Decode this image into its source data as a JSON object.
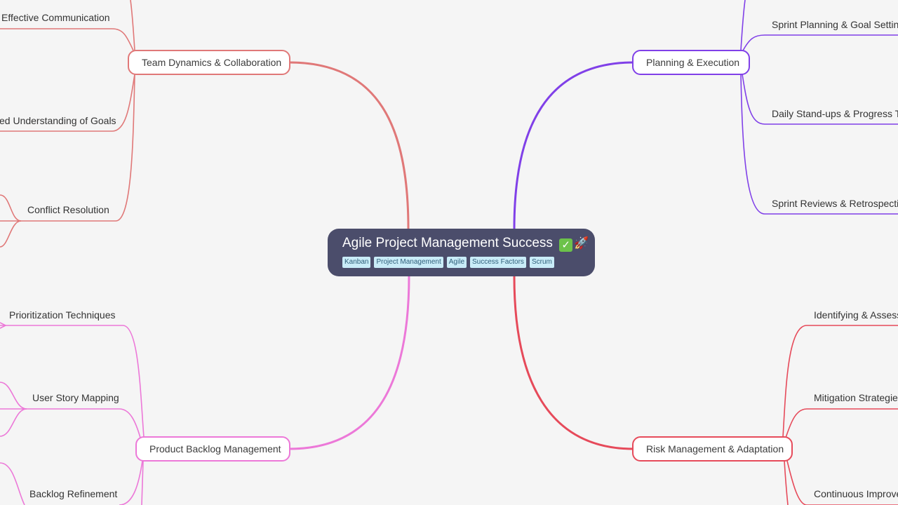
{
  "root": {
    "title": "Agile Project Management Success",
    "emoji_check": "✓",
    "emoji_rocket": "🚀",
    "tags": [
      "Kanban",
      "Project Management",
      "Agile",
      "Success Factors",
      "Scrum"
    ],
    "colors": {
      "background": "#4b4d6b",
      "tag_bg": "#c9ecf8",
      "tag_text": "#2f5f7a"
    }
  },
  "branches": {
    "team": {
      "label": "Team Dynamics & Collaboration",
      "color": "#e07878",
      "children": [
        "Effective Communication",
        "Shared Understanding of Goals",
        "Conflict Resolution"
      ]
    },
    "planning": {
      "label": "Planning & Execution",
      "color": "#8040e8",
      "children": [
        "Sprint Planning & Goal Setting",
        "Daily Stand-ups & Progress Tracking",
        "Sprint Reviews & Retrospectives"
      ]
    },
    "backlog": {
      "label": "Product Backlog Management",
      "color": "#ec78d8",
      "children": [
        "Prioritization Techniques",
        "User Story Mapping",
        "Backlog Refinement"
      ]
    },
    "risk": {
      "label": "Risk Management & Adaptation",
      "color": "#e64a5a",
      "children": [
        "Identifying & Assessing Risks",
        "Mitigation Strategies",
        "Continuous Improvement"
      ]
    }
  },
  "visible_leaf_text": {
    "team_1": "Effective Communication",
    "team_2": "ed Understanding of Goals",
    "team_3": "Conflict Resolution",
    "planning_1": "Sprint Planning & Goal Setting",
    "planning_2": "Daily Stand-ups & Progress Tra",
    "planning_3": "Sprint Reviews & Retrospective",
    "backlog_1": "Prioritization Techniques",
    "backlog_2": "User Story Mapping",
    "backlog_3": "Backlog Refinement",
    "risk_1": "Identifying & Assessi",
    "risk_2": "Mitigation Strategies",
    "risk_3": "Continuous Improve"
  }
}
